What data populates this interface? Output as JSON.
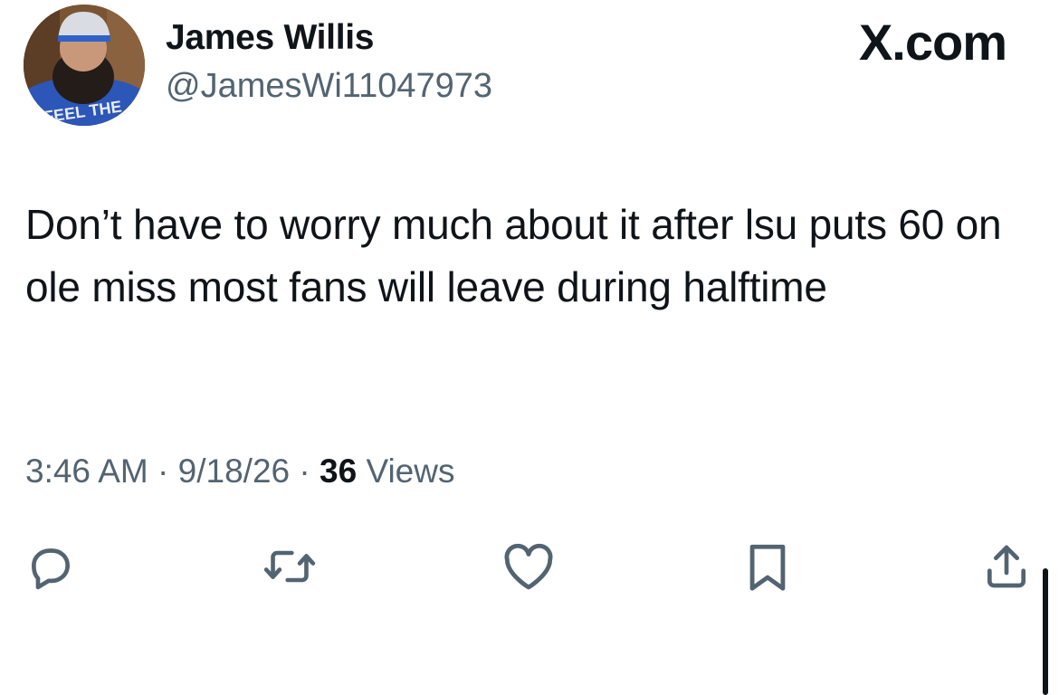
{
  "author": {
    "display_name": "James Willis",
    "handle": "@JamesWi11047973",
    "avatar_icon": "profile-photo"
  },
  "brand": {
    "label": "X.com"
  },
  "tweet": {
    "text": "Don’t have to worry much about it after lsu puts 60 on ole miss most fans will leave during halftime"
  },
  "meta": {
    "time": "3:46 AM",
    "date": "9/18/26",
    "separator": "·",
    "views_count": "36",
    "views_label": "Views"
  },
  "actions": {
    "reply_icon": "reply-icon",
    "retweet_icon": "retweet-icon",
    "like_icon": "heart-icon",
    "bookmark_icon": "bookmark-icon",
    "share_icon": "share-icon"
  },
  "colors": {
    "text": "#0f1419",
    "secondary": "#536471",
    "icon": "#536471",
    "background": "#ffffff"
  }
}
